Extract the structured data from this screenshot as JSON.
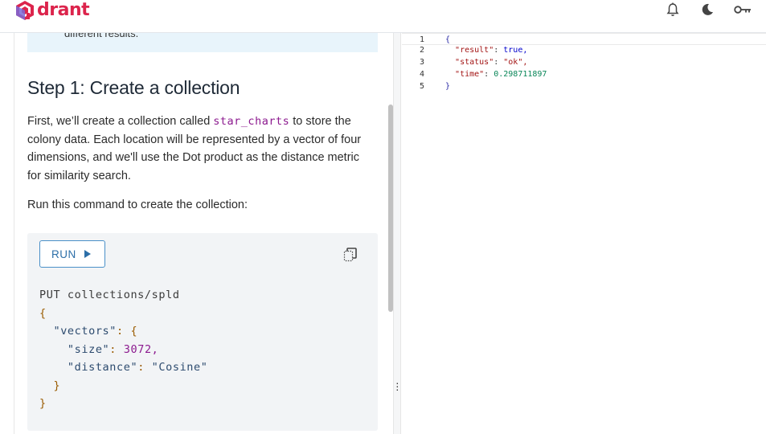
{
  "header": {
    "logo_text": "drant",
    "icons": [
      "bell-icon",
      "moon-icon",
      "key-icon"
    ]
  },
  "left": {
    "note_text": "different results.",
    "step_title": "Step 1: Create a collection",
    "para1_before": "First, we’ll create a collection called ",
    "para1_code": "star_charts",
    "para1_after": " to store the colony data. Each location will be represented by a vector of four dimensions, and we'll use the Dot product as the distance metric for similarity search.",
    "para2": "Run this command to create the collection:",
    "run_label": "RUN",
    "code": {
      "line1": "PUT collections/spld",
      "open": "{",
      "vectors_key": "\"vectors\"",
      "vectors_open": ": {",
      "size_key": "\"size\"",
      "size_colon": ": ",
      "size_val": "3072,",
      "distance_key": "\"distance\"",
      "distance_colon": ": ",
      "distance_val": "\"Cosine\"",
      "inner_close": "}",
      "close": "}"
    }
  },
  "response": {
    "lines": [
      {
        "num": "1",
        "open": "{"
      },
      {
        "num": "2",
        "key": "\"result\"",
        "value": "true,"
      },
      {
        "num": "3",
        "key": "\"status\"",
        "value": "\"ok\","
      },
      {
        "num": "4",
        "key": "\"time\"",
        "value": "0.298711897"
      },
      {
        "num": "5",
        "close": "}"
      }
    ]
  },
  "colors": {
    "brand": "#dc244c",
    "accent": "#2c6fa8",
    "code_bg": "#f2f4f6",
    "note_bg": "#e8f4fb"
  }
}
